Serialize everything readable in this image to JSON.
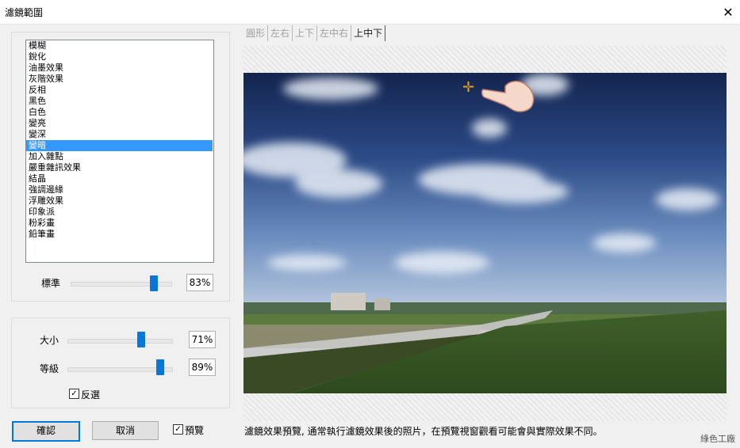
{
  "window": {
    "title": "濾鏡範圍"
  },
  "filter_list": {
    "items": [
      "模糊",
      "銳化",
      "油墨效果",
      "灰階效果",
      "反相",
      "黑色",
      "白色",
      "變亮",
      "變深",
      "變暗",
      "加入雜點",
      "嚴重雜訊效果",
      "結晶",
      "強調邊緣",
      "浮雕效果",
      "印象派",
      "粉彩畫",
      "鉛筆畫"
    ],
    "selected_index": 9
  },
  "standard": {
    "label": "標準",
    "value": "83%",
    "level": 0.83
  },
  "size": {
    "label": "大小",
    "value": "71%",
    "level": 0.71
  },
  "grade": {
    "label": "等級",
    "value": "89%",
    "level": 0.89
  },
  "invert": {
    "label": "反選",
    "checked": true
  },
  "preview_toggle": {
    "label": "預覽",
    "checked": true
  },
  "buttons": {
    "ok": "確認",
    "cancel": "取消"
  },
  "tabs": [
    "圓形",
    "左右",
    "上下",
    "左中右",
    "上中下"
  ],
  "active_tab": 4,
  "caption": "濾鏡效果預覽, 通常執行濾鏡效果後的照片，在預覽視窗觀看可能會與實際效果不同。",
  "watermark": "綠色工廠",
  "icons": {
    "close": "close-icon",
    "cursor": "move-cursor-icon",
    "hand": "pointing-hand-icon"
  },
  "colors": {
    "accent": "#0a77d6",
    "selection": "#3399ff"
  }
}
